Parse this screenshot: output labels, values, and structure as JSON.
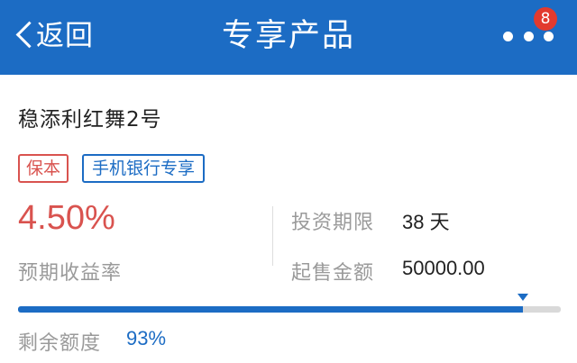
{
  "header": {
    "back_label": "返回",
    "title": "专享产品",
    "notification_count": "8",
    "bg_color": "#1c6cc4"
  },
  "product": {
    "name": "稳添利红舞2号",
    "tags": [
      "保本",
      "手机银行专享"
    ],
    "rate": "4.50%",
    "rate_label": "预期收益率",
    "term_label": "投资期限",
    "term_value": "38 天",
    "min_amount_label": "起售金额",
    "min_amount_value": "50000.00",
    "remaining_label": "剩余额度",
    "remaining_value": "93%",
    "remaining_fraction": 0.93
  },
  "colors": {
    "accent": "#1c6cc4",
    "highlight_red": "#d9534f",
    "muted_text": "#9a9a9a"
  },
  "icons": {
    "back": "chevron-left-icon",
    "more": "more-dots-icon"
  }
}
